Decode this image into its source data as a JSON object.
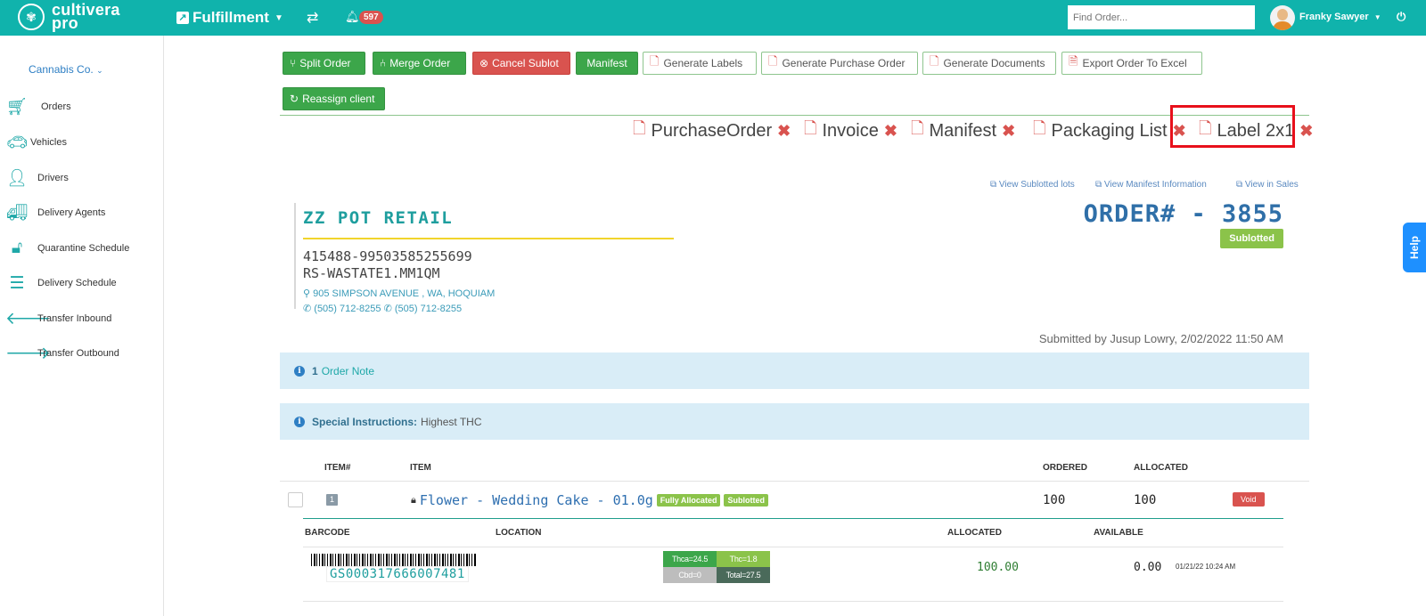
{
  "topbar": {
    "logo_line1": "cultivera",
    "logo_line2": "pro",
    "module": "Fulfillment",
    "notifications_count": "597",
    "search_placeholder": "Find Order...",
    "user_name": "Franky Sawyer"
  },
  "sidebar": {
    "client": "Cannabis Co.",
    "items": [
      {
        "label": "Orders",
        "icon": "cart-icon"
      },
      {
        "label": "Vehicles",
        "icon": "car-icon"
      },
      {
        "label": "Drivers",
        "icon": "user-icon"
      },
      {
        "label": "Delivery Agents",
        "icon": "truck-icon"
      },
      {
        "label": "Quarantine Schedule",
        "icon": "unlock-icon"
      },
      {
        "label": "Delivery Schedule",
        "icon": "list-icon"
      },
      {
        "label": "Transfer Inbound",
        "icon": "arrow-left-icon"
      },
      {
        "label": "Transfer Outbound",
        "icon": "arrow-right-icon"
      }
    ]
  },
  "toolbar": {
    "split": "Split Order",
    "merge": "Merge Order",
    "cancel": "Cancel Sublot",
    "manifest": "Manifest",
    "gen_labels": "Generate Labels",
    "gen_po": "Generate Purchase Order",
    "gen_docs": "Generate Documents",
    "export": "Export Order To Excel",
    "reassign": "Reassign client"
  },
  "documents": [
    "PurchaseOrder",
    "Invoice",
    "Manifest",
    "Packaging List",
    "Label 2x1"
  ],
  "links": {
    "sublotted": "View Sublotted lots",
    "manifest_info": "View Manifest Information",
    "in_sales": "View in Sales"
  },
  "customer": {
    "name": "ZZ POT RETAIL",
    "license": "415488-99503585255699",
    "store": "RS-WASTATE1.MM1QM",
    "address": "905 SIMPSON AVENUE , WA, HOQUIAM",
    "phone1": "(505) 712-8255",
    "phone2": "(505) 712-8255"
  },
  "order": {
    "number": "ORDER# - 3855",
    "status": "Sublotted",
    "submitted": "Submitted by Jusup Lowry, 2/02/2022 11:50 AM"
  },
  "notes": {
    "count": "1",
    "label": "Order Note",
    "special_label": "Special Instructions:",
    "special_value": "Highest THC"
  },
  "items_table": {
    "headers": {
      "item_num": "ITEM#",
      "item": "ITEM",
      "ordered": "ORDERED",
      "allocated": "ALLOCATED"
    },
    "rows": [
      {
        "num": "1",
        "name": "Flower - Wedding Cake - 01.0g",
        "tags": [
          "Fully Allocated",
          "Sublotted"
        ],
        "ordered": "100",
        "allocated": "100",
        "void": "Void"
      }
    ]
  },
  "sublot_table": {
    "headers": {
      "barcode": "BARCODE",
      "location": "LOCATION",
      "allocated": "ALLOCATED",
      "available": "AVAILABLE"
    },
    "rows": [
      {
        "barcode": "GS000317666007481",
        "thca": "Thca=24.5",
        "thc": "Thc=1.8",
        "cbd": "Cbd=0",
        "total": "Total=27.5",
        "allocated": "100.00",
        "available": "0.00",
        "date": "01/21/22 10:24 AM"
      }
    ]
  },
  "help": "Help"
}
